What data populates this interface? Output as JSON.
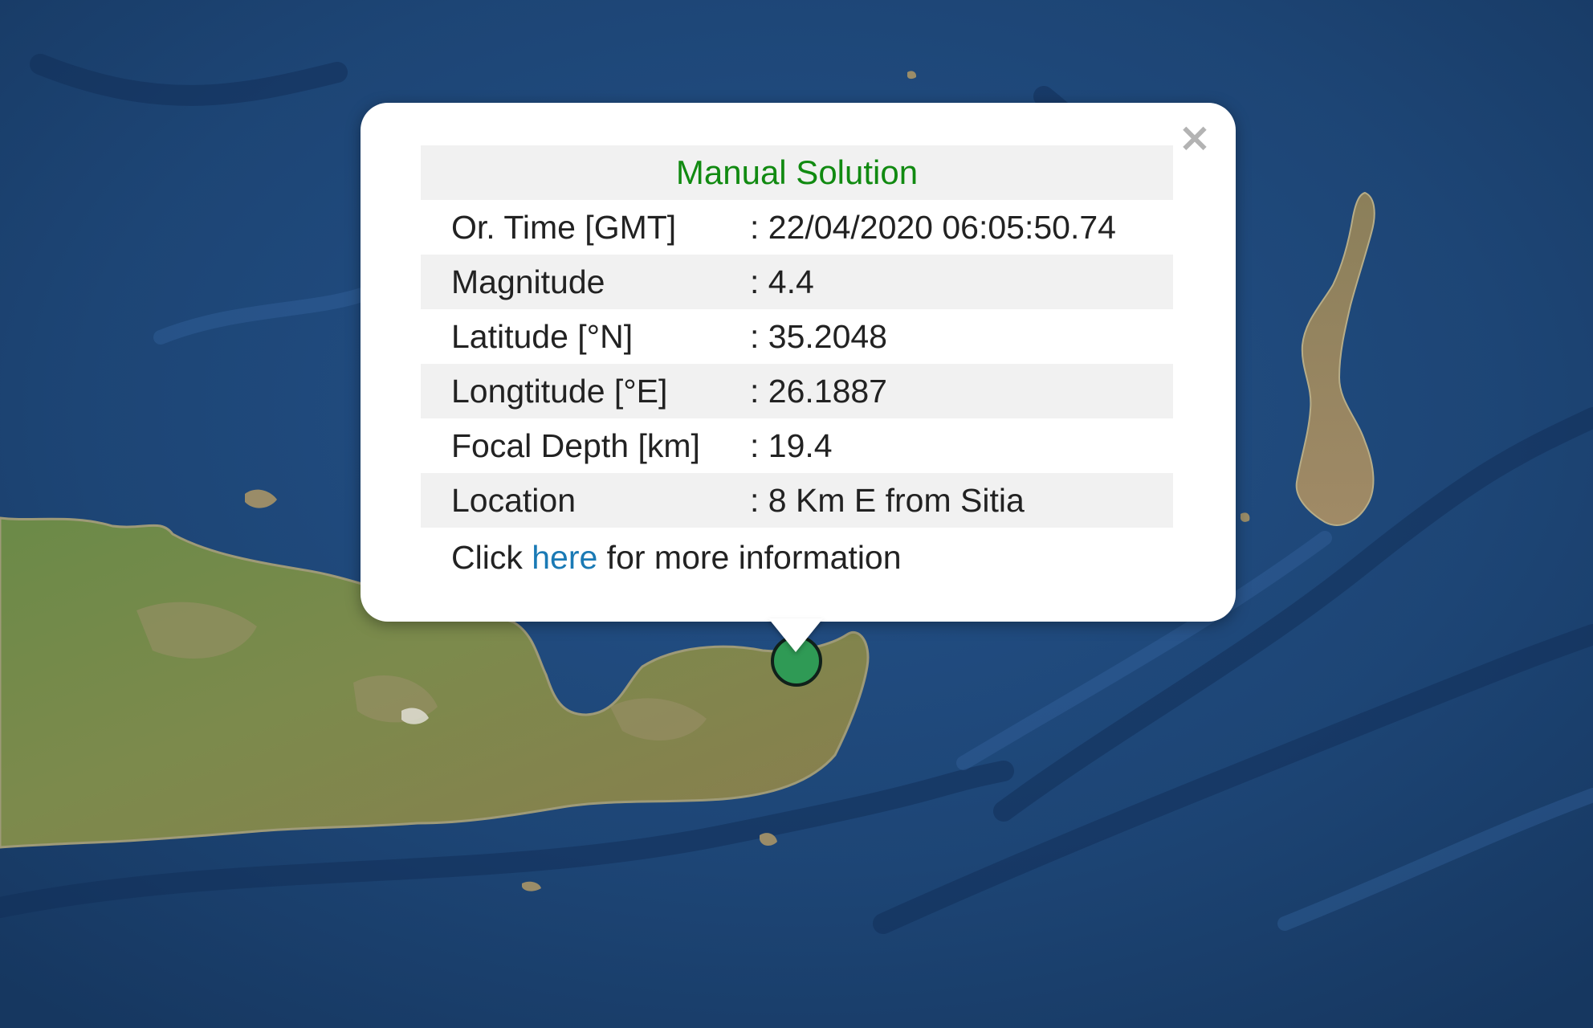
{
  "map": {
    "sea_color": "#1f4878",
    "land_color": "#6f8a4a",
    "marker_color": "#2f9a55"
  },
  "popup": {
    "close_symbol": "×",
    "title": "Manual Solution",
    "title_color": "#118a11",
    "rows": [
      {
        "label": "Or. Time [GMT]",
        "value": ": 22/04/2020 06:05:50.74"
      },
      {
        "label": "Magnitude",
        "value": ": 4.4"
      },
      {
        "label": "Latitude [°N]",
        "value": ": 35.2048"
      },
      {
        "label": "Longtitude [°E]",
        "value": ": 26.1887"
      },
      {
        "label": "Focal Depth [km]",
        "value": ": 19.4"
      },
      {
        "label": "Location",
        "value": ": 8 Km E from Sitia"
      }
    ],
    "footer": {
      "prefix": "Click ",
      "link_text": "here",
      "suffix": " for more information",
      "link_color": "#1a7ab5"
    }
  },
  "icons": {
    "close": "close-icon",
    "marker": "epicenter-marker-icon"
  }
}
